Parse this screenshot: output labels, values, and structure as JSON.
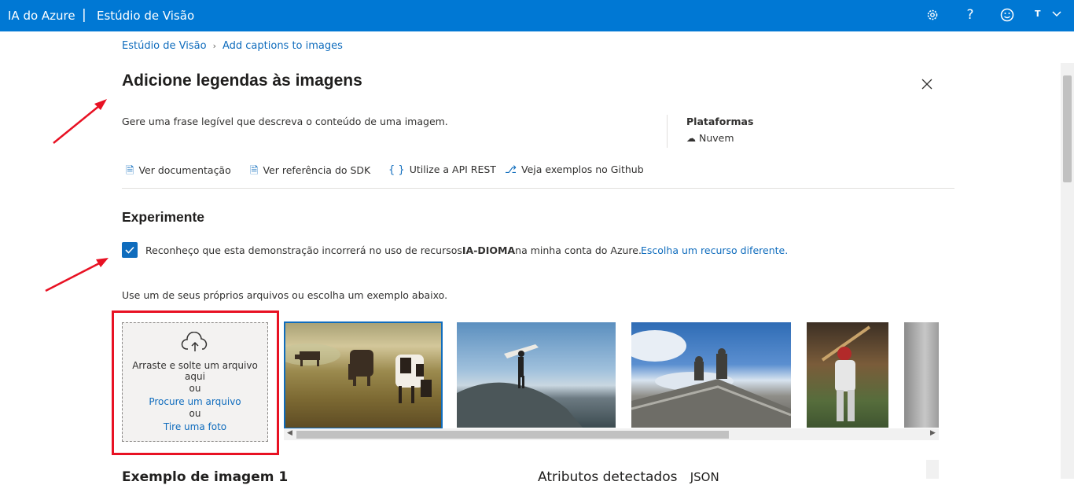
{
  "topbar": {
    "brand": "IA do Azure",
    "separator": "|",
    "studio": "Estúdio de Visão",
    "avatar_initial": "T"
  },
  "breadcrumb": {
    "home": "Estúdio de Visão",
    "current": "Add captions to images"
  },
  "page": {
    "title": "Adicione legendas às imagens",
    "description": "Gere uma frase legível que descreva o conteúdo de uma imagem.",
    "platforms_label": "Plataformas",
    "platforms_value": "Nuvem"
  },
  "links": {
    "docs": "Ver documentação",
    "sdk": "Ver referência do SDK",
    "api": "Utilize a API REST",
    "github": "Veja exemplos no Github"
  },
  "try": {
    "title": "Experimente",
    "checked": true,
    "ack_prefix": "Reconheço que esta demonstração incorrerá no uso de recursos",
    "resource_name": "IA-DIOMA",
    "ack_suffix": "na minha conta do Azure.",
    "change_resource": "Escolha um recurso diferente.",
    "hint": "Use um de seus próprios arquivos ou escolha um exemplo abaixo."
  },
  "dropzone": {
    "line1": "Arraste e solte um arquivo",
    "line2": "aqui",
    "or1": "ou",
    "browse": "Procure um arquivo",
    "or2": "ou",
    "photo": "Tire uma foto"
  },
  "examples": [
    "cows-grazing-image",
    "surfer-on-rock-image",
    "building-statues-image",
    "baseball-player-image",
    "gray-gradient-image"
  ],
  "bottom": {
    "left_heading": "Exemplo de imagem 1",
    "right_heading": "Atributos detectados",
    "right_tab": "JSON"
  },
  "colors": {
    "topbar": "#0078d4",
    "link": "#0f6cbd",
    "annotation": "#e81123"
  }
}
